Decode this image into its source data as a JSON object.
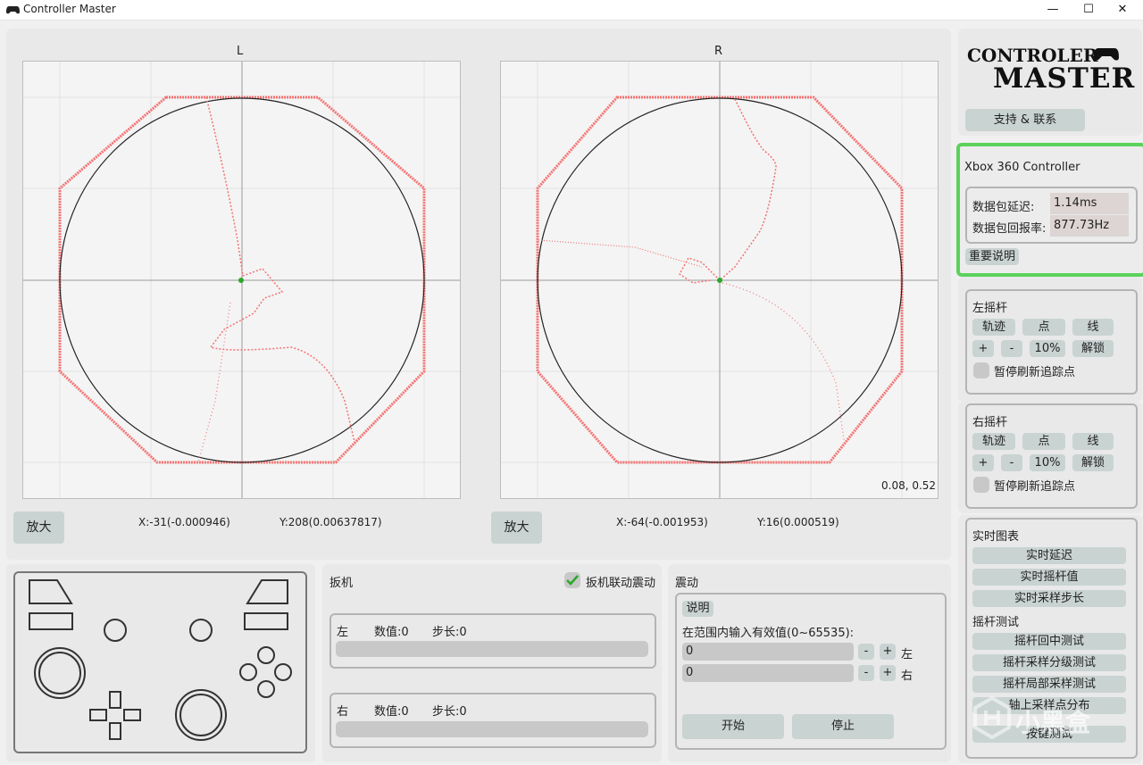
{
  "window": {
    "title": "Controller Master",
    "min": "—",
    "max": "☐",
    "close": "✕"
  },
  "left_stick": {
    "label": "L",
    "zoom": "放大",
    "x_readout": "X:-31(-0.000946)",
    "y_readout": "Y:208(0.00637817)"
  },
  "right_stick": {
    "label": "R",
    "zoom": "放大",
    "x_readout": "X:-64(-0.001953)",
    "y_readout": "Y:16(0.000519)",
    "corner": "0.08, 0.52"
  },
  "logo": {
    "line1": "CONTROLER",
    "line2": "MASTER"
  },
  "support_button": "支持 & 联系",
  "device": {
    "name": "Xbox 360 Controller",
    "latency_label": "数据包延迟:",
    "latency_value": "1.14ms",
    "rate_label": "数据包回报率:",
    "rate_value": "877.73Hz",
    "notice_button": "重要说明"
  },
  "left_panel": {
    "title": "左摇杆",
    "trace": "轨迹",
    "point": "点",
    "line": "线",
    "plus": "+",
    "minus": "-",
    "percent": "10%",
    "unlock": "解锁",
    "pause": "暂停刷新追踪点"
  },
  "right_panel": {
    "title": "右摇杆",
    "trace": "轨迹",
    "point": "点",
    "line": "线",
    "plus": "+",
    "minus": "-",
    "percent": "10%",
    "unlock": "解锁",
    "pause": "暂停刷新追踪点"
  },
  "realtime": {
    "title": "实时图表",
    "items": [
      "实时延迟",
      "实时摇杆值",
      "实时采样步长"
    ]
  },
  "stick_test": {
    "title": "摇杆测试",
    "items": [
      "摇杆回中测试",
      "摇杆采样分级测试",
      "摇杆局部采样测试",
      "轴上采样点分布",
      "按键测试"
    ]
  },
  "trigger": {
    "title": "扳机",
    "link_label": "扳机联动震动",
    "left": {
      "side": "左",
      "value": "数值:0",
      "step": "步长:0"
    },
    "right": {
      "side": "右",
      "value": "数值:0",
      "step": "步长:0"
    }
  },
  "vibration": {
    "title": "震动",
    "explain": "说明",
    "hint": "在范围内输入有效值(0~65535):",
    "left_value": "0",
    "right_value": "0",
    "minus": "-",
    "plus": "+",
    "left": "左",
    "right": "右",
    "start": "开始",
    "stop": "停止"
  },
  "watermark": "小黑盒"
}
